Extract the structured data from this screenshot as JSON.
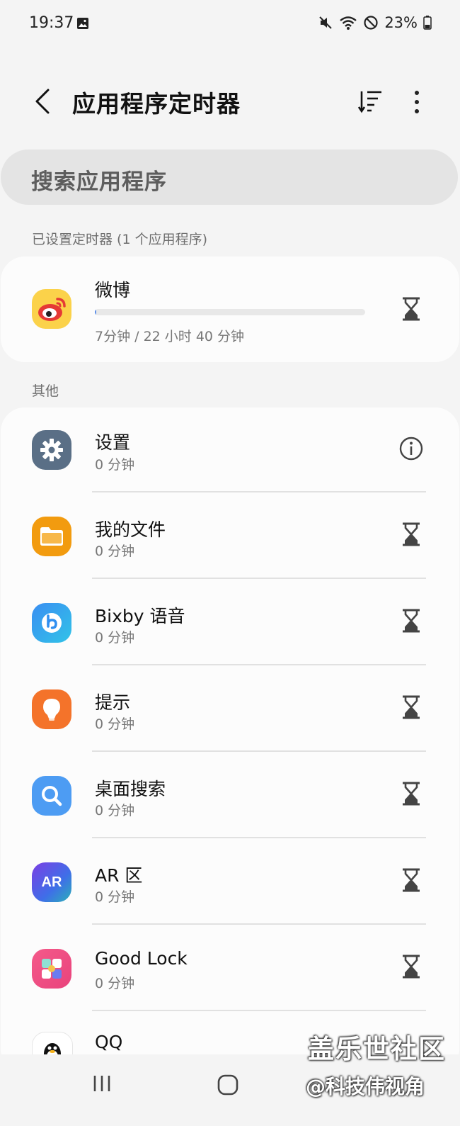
{
  "status_bar": {
    "time": "19:37",
    "battery": "23%"
  },
  "header": {
    "title": "应用程序定时器"
  },
  "search": {
    "placeholder": "搜索应用程序"
  },
  "timer_section": {
    "label": "已设置定时器 (1 个应用程序)",
    "apps": [
      {
        "name": "微博",
        "usage": "7分钟 / 22 小时 40 分钟",
        "progress_fraction": 0.005,
        "icon": "weibo-icon",
        "action": "hourglass-icon"
      }
    ]
  },
  "other_section": {
    "label": "其他",
    "apps": [
      {
        "name": "设置",
        "usage": "0 分钟",
        "icon": "settings-gear-icon",
        "icon_color": "#5a6f86",
        "action": "info-icon"
      },
      {
        "name": "我的文件",
        "usage": "0 分钟",
        "icon": "folder-icon",
        "icon_color": "#f29b0f",
        "action": "hourglass-icon"
      },
      {
        "name": "Bixby 语音",
        "usage": "0 分钟",
        "icon": "bixby-icon",
        "icon_color": "#2f8ff0",
        "action": "hourglass-icon"
      },
      {
        "name": "提示",
        "usage": "0 分钟",
        "icon": "lightbulb-icon",
        "icon_color": "#f4732a",
        "action": "hourglass-icon"
      },
      {
        "name": "桌面搜索",
        "usage": "0 分钟",
        "icon": "search-magnifier-icon",
        "icon_color": "#4d9cf3",
        "action": "hourglass-icon"
      },
      {
        "name": "AR 区",
        "usage": "0 分钟",
        "icon": "ar-zone-icon",
        "icon_label": "AR",
        "icon_color": "#5a4fe0",
        "action": "hourglass-icon"
      },
      {
        "name": "Good Lock",
        "usage": "0 分钟",
        "icon": "good-lock-icon",
        "icon_color": "#e94a8a",
        "action": "hourglass-icon"
      },
      {
        "name": "QQ",
        "usage": "",
        "icon": "qq-penguin-icon",
        "action": ""
      }
    ]
  },
  "watermark": {
    "main": "盖乐世社区",
    "sub": "@科技伟视角"
  }
}
